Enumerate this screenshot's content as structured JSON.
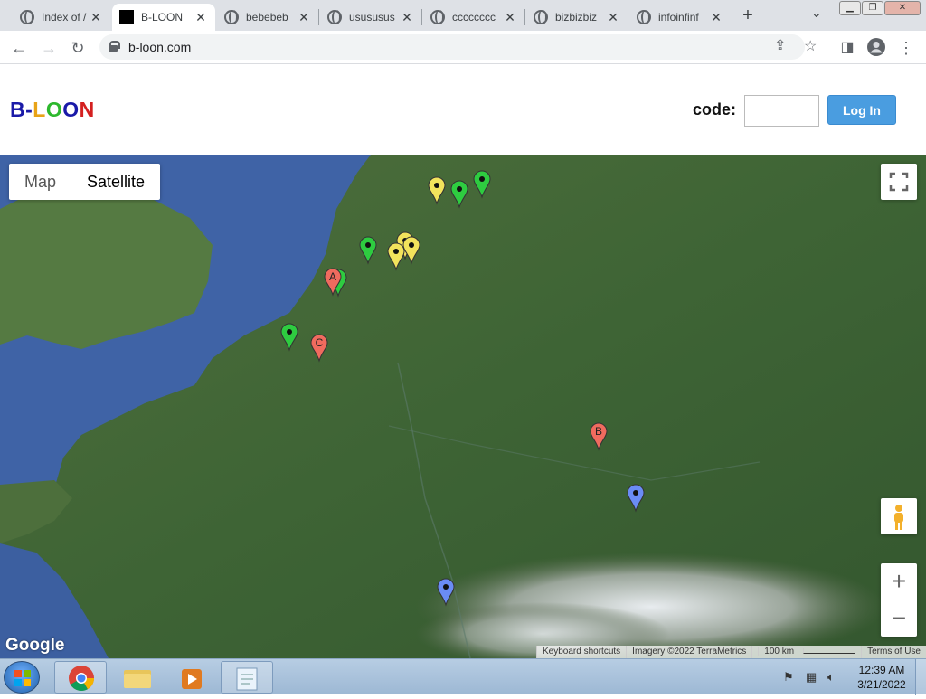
{
  "browser": {
    "tabs": [
      {
        "title": "Index of /",
        "icon": "globe-icon",
        "active": false
      },
      {
        "title": "B-LOON",
        "icon": "black-square-icon",
        "active": true
      },
      {
        "title": "bebebeb",
        "icon": "globe-icon",
        "active": false
      },
      {
        "title": "usususus",
        "icon": "globe-icon",
        "active": false
      },
      {
        "title": "cccccccc",
        "icon": "globe-icon",
        "active": false
      },
      {
        "title": "bizbizbiz",
        "icon": "globe-icon",
        "active": false
      },
      {
        "title": "infoinfinf",
        "icon": "globe-icon",
        "active": false
      }
    ],
    "new_tab": "+",
    "url": "b-loon.com"
  },
  "page": {
    "logo_letters": [
      {
        "ch": "B",
        "color": "#1a1aa8"
      },
      {
        "ch": "-",
        "color": "#1a1aa8"
      },
      {
        "ch": "L",
        "color": "#e8a317"
      },
      {
        "ch": "O",
        "color": "#2db82d"
      },
      {
        "ch": "O",
        "color": "#1a1aa8"
      },
      {
        "ch": "N",
        "color": "#d42020"
      }
    ],
    "code_label": "code:",
    "code_value": "",
    "login_label": "Log In"
  },
  "map": {
    "map_types": {
      "map": "Map",
      "satellite": "Satellite",
      "selected": "Satellite"
    },
    "google_logo": "Google",
    "attribution": {
      "shortcuts": "Keyboard shortcuts",
      "imagery": "Imagery ©2022 TerraMetrics",
      "scale": "100 km",
      "terms": "Terms of Use"
    },
    "zoom_in": "+",
    "zoom_out": "−",
    "marker_colors": {
      "yellow": "#f2e35c",
      "green": "#2ecc40",
      "red": "#f06b5e",
      "blue": "#6a8cf5"
    },
    "marker_labels": [
      "A",
      "B",
      "C"
    ]
  },
  "taskbar": {
    "time": "12:39 AM",
    "date": "3/21/2022"
  }
}
